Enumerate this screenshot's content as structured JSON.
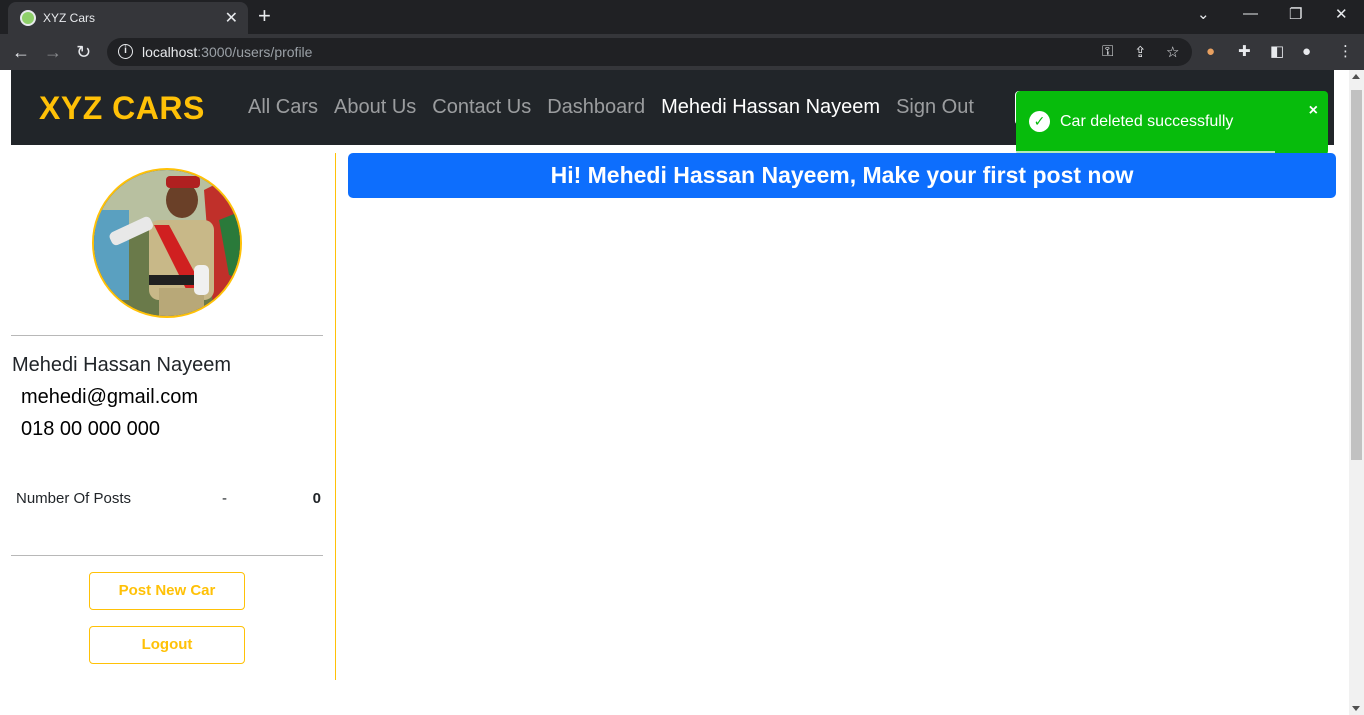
{
  "browser": {
    "tab_title": "XYZ Cars",
    "tab_close": "✕",
    "new_tab": "+",
    "url_host": "localhost",
    "url_path": ":3000/users/profile"
  },
  "navbar": {
    "brand": "XYZ CARS",
    "links": [
      {
        "label": "All Cars",
        "active": false
      },
      {
        "label": "About Us",
        "active": false
      },
      {
        "label": "Contact Us",
        "active": false
      },
      {
        "label": "Dashboard",
        "active": false
      },
      {
        "label": "Mehedi Hassan Nayeem",
        "active": true
      },
      {
        "label": "Sign Out",
        "active": false
      }
    ]
  },
  "toast": {
    "message": "Car deleted successfully",
    "type": "success",
    "color": "#07bc0c",
    "close": "×",
    "progress_remaining": 0.83
  },
  "profile": {
    "name": "Mehedi Hassan Nayeem",
    "email": "mehedi@gmail.com",
    "phone": "018 00 000 000",
    "posts_label": "Number Of Posts",
    "posts_sep": "-",
    "posts_count": "0"
  },
  "actions": {
    "post_new_car": "Post New Car",
    "logout": "Logout"
  },
  "main": {
    "banner": "Hi! Mehedi Hassan Nayeem, Make your first post now"
  },
  "colors": {
    "accent": "#ffc107",
    "primary": "#0d6efd",
    "navbar_bg": "#212529"
  }
}
